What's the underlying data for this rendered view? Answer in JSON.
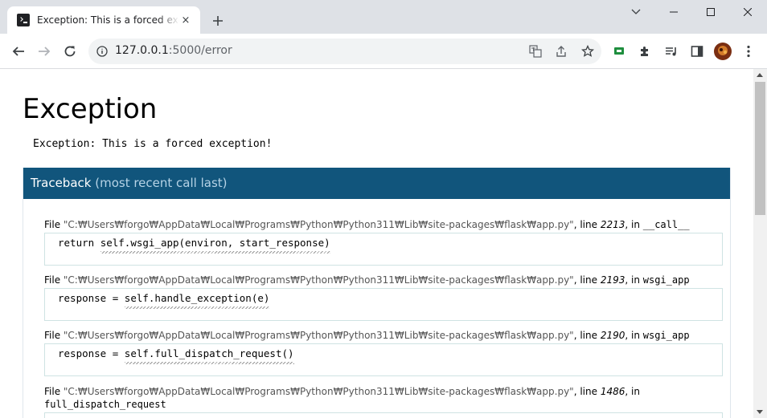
{
  "browser": {
    "tab_title": "Exception: This is a forced exception!",
    "tab_close": "×",
    "url_host": "127.0.0.1",
    "url_path": ":5000/error"
  },
  "page": {
    "title": "Exception",
    "message": "Exception: This is a forced exception!",
    "traceback_label": "Traceback",
    "traceback_sub": "(most recent call last)",
    "frames": [
      {
        "file_prefix": "File ",
        "file": "\"C:₩Users₩forgo₩AppData₩Local₩Programs₩Python₩Python311₩Lib₩site-packages₩flask₩app.py\"",
        "line_prefix": ", line ",
        "line": "2213",
        "in_prefix": ", in ",
        "func": "__call__",
        "code_pre": "return ",
        "code_hl": "self.wsgi_app(environ, start_response)"
      },
      {
        "file_prefix": "File ",
        "file": "\"C:₩Users₩forgo₩AppData₩Local₩Programs₩Python₩Python311₩Lib₩site-packages₩flask₩app.py\"",
        "line_prefix": ", line ",
        "line": "2193",
        "in_prefix": ", in ",
        "func": "wsgi_app",
        "code_pre": "response = ",
        "code_hl": "self.handle_exception(e)"
      },
      {
        "file_prefix": "File ",
        "file": "\"C:₩Users₩forgo₩AppData₩Local₩Programs₩Python₩Python311₩Lib₩site-packages₩flask₩app.py\"",
        "line_prefix": ", line ",
        "line": "2190",
        "in_prefix": ", in ",
        "func": "wsgi_app",
        "code_pre": "response = ",
        "code_hl": "self.full_dispatch_request()"
      },
      {
        "file_prefix": "File ",
        "file": "\"C:₩Users₩forgo₩AppData₩Local₩Programs₩Python₩Python311₩Lib₩site-packages₩flask₩app.py\"",
        "line_prefix": ", line ",
        "line": "1486",
        "in_prefix": ", in",
        "func": "full_dispatch_request"
      }
    ]
  },
  "colors": {
    "traceback_header": "#11557c",
    "traceback_sub": "#b6d3e6"
  }
}
